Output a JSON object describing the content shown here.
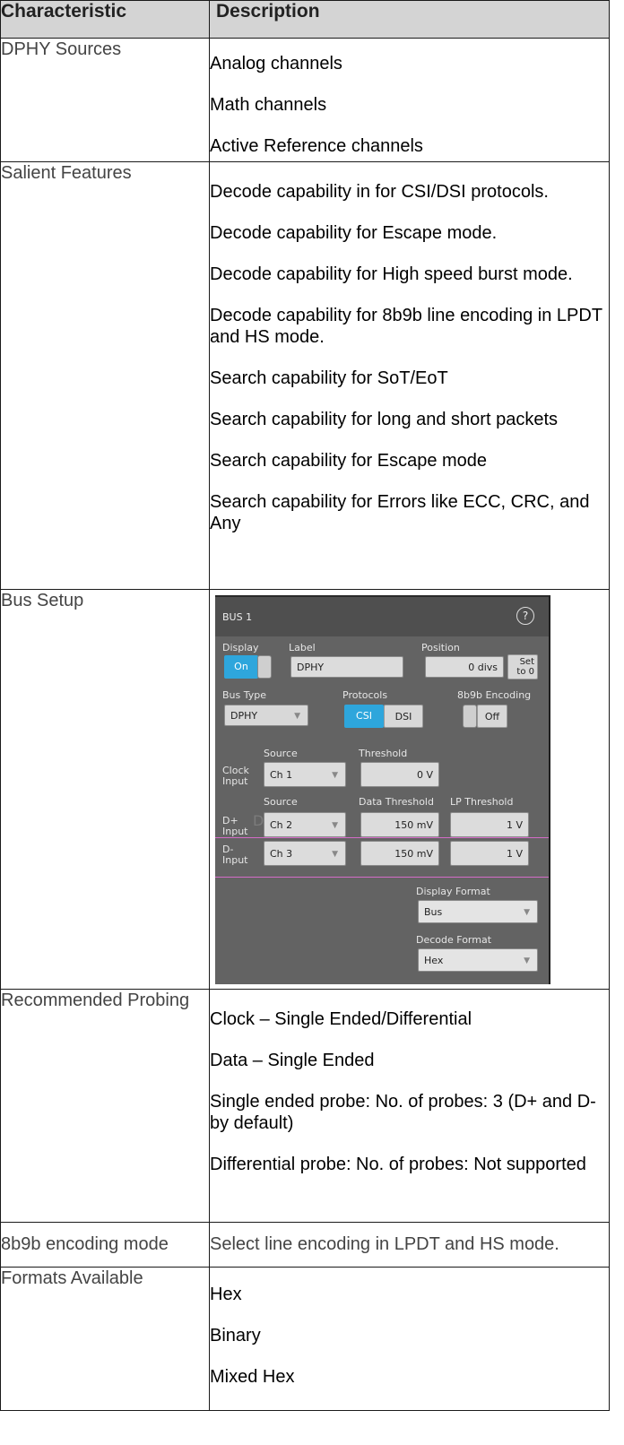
{
  "headers": {
    "characteristic": "Characteristic",
    "description": "Description"
  },
  "rows": [
    {
      "label": "DPHY Sources",
      "items": [
        "Analog channels",
        "Math channels",
        "Active Reference channels"
      ]
    },
    {
      "label": "Salient Features",
      "items": [
        "Decode capability in for CSI/DSI protocols.",
        "Decode capability for Escape mode.",
        "Decode capability for High speed burst mode.",
        "Decode capability for 8b9b line encoding in LPDT and HS mode.",
        "Search capability for SoT/EoT",
        "Search capability for long and short packets",
        "Search capability for Escape mode",
        "Search capability for Errors like ECC, CRC, and Any"
      ]
    },
    {
      "label": "Bus Setup"
    },
    {
      "label": "Recommended Probing",
      "items": [
        "Clock – Single Ended/Differential",
        "Data – Single Ended",
        "Single ended probe: No. of probes: 3 (D+ and D- by default)",
        "Differential probe: No. of probes: Not supported"
      ]
    },
    {
      "label": "8b9b encoding mode",
      "items": [
        "Select line encoding in LPDT and HS mode."
      ]
    },
    {
      "label": "Formats Available",
      "items": [
        "Hex",
        "Binary",
        "Mixed Hex"
      ]
    }
  ],
  "bus_panel": {
    "title": "BUS 1",
    "help_icon": "question-circle-icon",
    "display_label": "Display",
    "display_value": "On",
    "label_label": "Label",
    "label_value": "DPHY",
    "position_label": "Position",
    "position_value": "0 divs",
    "set_to_zero_line1": "Set",
    "set_to_zero_line2": "to 0",
    "bus_type_label": "Bus Type",
    "bus_type_value": "DPHY",
    "protocols_label": "Protocols",
    "protocol_csi": "CSI",
    "protocol_dsi": "DSI",
    "encoding_label": "8b9b Encoding",
    "encoding_value": "Off",
    "source_label": "Source",
    "threshold_label": "Threshold",
    "clock_input_line1": "Clock",
    "clock_input_line2": "Input",
    "clock_source": "Ch 1",
    "clock_threshold": "0 V",
    "data_source_label": "Source",
    "data_threshold_label": "Data Threshold",
    "lp_threshold_label": "LP Threshold",
    "dplus_line1": "D+",
    "dplus_line2": "Input",
    "dplus_source": "Ch 2",
    "dplus_data_threshold": "150 mV",
    "dplus_lp_threshold": "1 V",
    "dminus_line1": "D-",
    "dminus_line2": "Input",
    "dminus_source": "Ch 3",
    "dminus_data_threshold": "150 mV",
    "dminus_lp_threshold": "1 V",
    "display_format_label": "Display Format",
    "display_format_value": "Bus",
    "decode_format_label": "Decode Format",
    "decode_format_value": "Hex",
    "colors": {
      "accent": "#2ea6dc",
      "panel": "#636363",
      "trace": "#d46cc8"
    }
  }
}
